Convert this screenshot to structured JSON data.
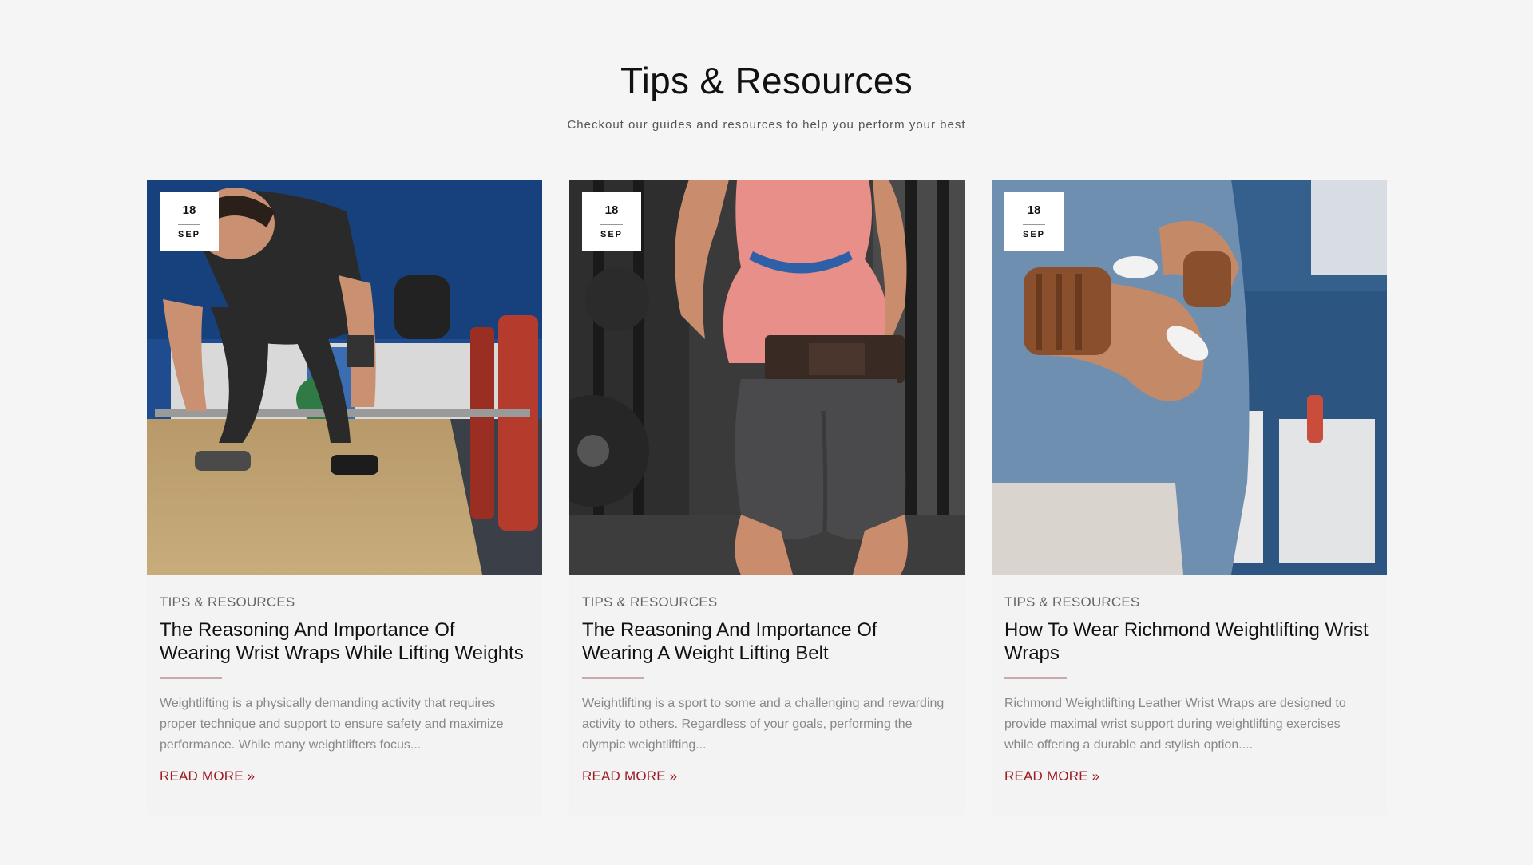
{
  "section": {
    "title": "Tips & Resources",
    "subtitle": "Checkout our guides and resources to help you perform your best"
  },
  "colors": {
    "accent": "#9b1b22",
    "divider": "#c9aaab",
    "background": "#f5f5f5"
  },
  "posts": [
    {
      "day": "18",
      "month": "SEP",
      "category": "TIPS & RESOURCES",
      "title": "The Reasoning And Importance Of Wearing Wrist Wraps While Lifting Weights",
      "excerpt": "Weightlifting is a physically demanding activity that requires proper technique and support to ensure safety and maximize performance. While many weightlifters focus...",
      "read_more": "READ MORE »"
    },
    {
      "day": "18",
      "month": "SEP",
      "category": "TIPS & RESOURCES",
      "title": "The Reasoning And Importance Of Wearing A Weight Lifting Belt",
      "excerpt": "Weightlifting is a sport to some and a challenging and rewarding activity to others. Regardless of your goals, performing the olympic weightlifting...",
      "read_more": "READ MORE »"
    },
    {
      "day": "18",
      "month": "SEP",
      "category": "TIPS & RESOURCES",
      "title": "How To Wear Richmond Weightlifting Wrist Wraps",
      "excerpt": "Richmond Weightlifting Leather Wrist Wraps are designed to provide maximal wrist support during weightlifting exercises while offering a durable and stylish option....",
      "read_more": "READ MORE »"
    }
  ]
}
